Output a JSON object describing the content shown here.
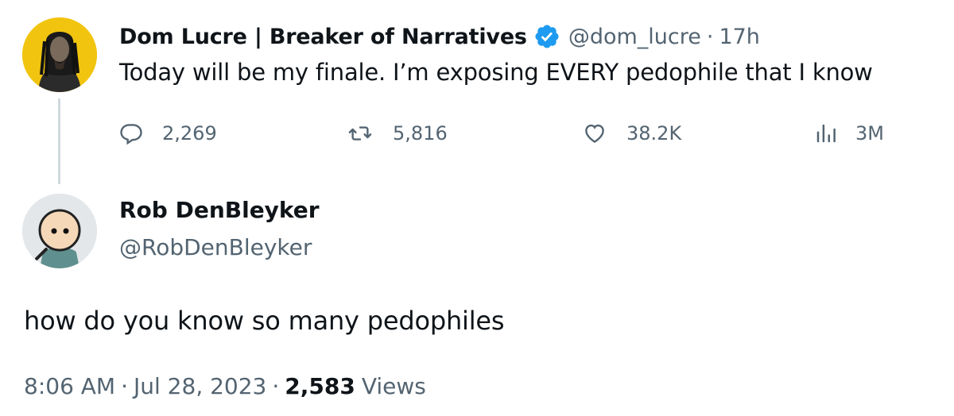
{
  "parent_tweet": {
    "display_name": "Dom Lucre | Breaker of Narratives",
    "handle": "@dom_lucre",
    "separator": "·",
    "time_ago": "17h",
    "text": "Today will be my finale. I’m exposing EVERY pedophile that I know",
    "verified_icon": "verified-badge-icon",
    "actions": {
      "replies": "2,269",
      "retweets": "5,816",
      "likes": "38.2K",
      "views": "3M"
    }
  },
  "reply_tweet": {
    "display_name": "Rob DenBleyker",
    "handle": "@RobDenBleyker",
    "text": "how do you know so many pedophiles",
    "time": "8:06 AM",
    "separator": "·",
    "date": "Jul 28, 2023",
    "views_count": "2,583",
    "views_label": "Views"
  },
  "colors": {
    "text": "#0f1419",
    "secondary": "#536471",
    "verified_blue": "#1d9bf0",
    "thread_line": "#cfd9de",
    "avatar1_bg": "#f1c40f"
  }
}
